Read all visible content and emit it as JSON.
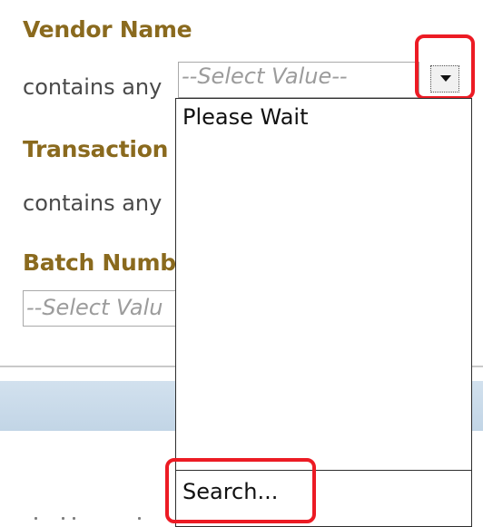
{
  "vendor": {
    "title": "Vendor Name",
    "operator": "contains any",
    "placeholder": "--Select Value--"
  },
  "transaction": {
    "title": "Transaction",
    "operator": "contains any"
  },
  "batch": {
    "title": "Batch Numb",
    "placeholder": "--Select Valu"
  },
  "dropdown": {
    "loading_text": "Please Wait",
    "search_label": "Search..."
  },
  "colors": {
    "section_title": "#8a6a1e",
    "highlight": "#ec1b24",
    "bar": "#c8d9e8"
  },
  "icons": {
    "dropdown_button": "chevron-down-icon"
  }
}
